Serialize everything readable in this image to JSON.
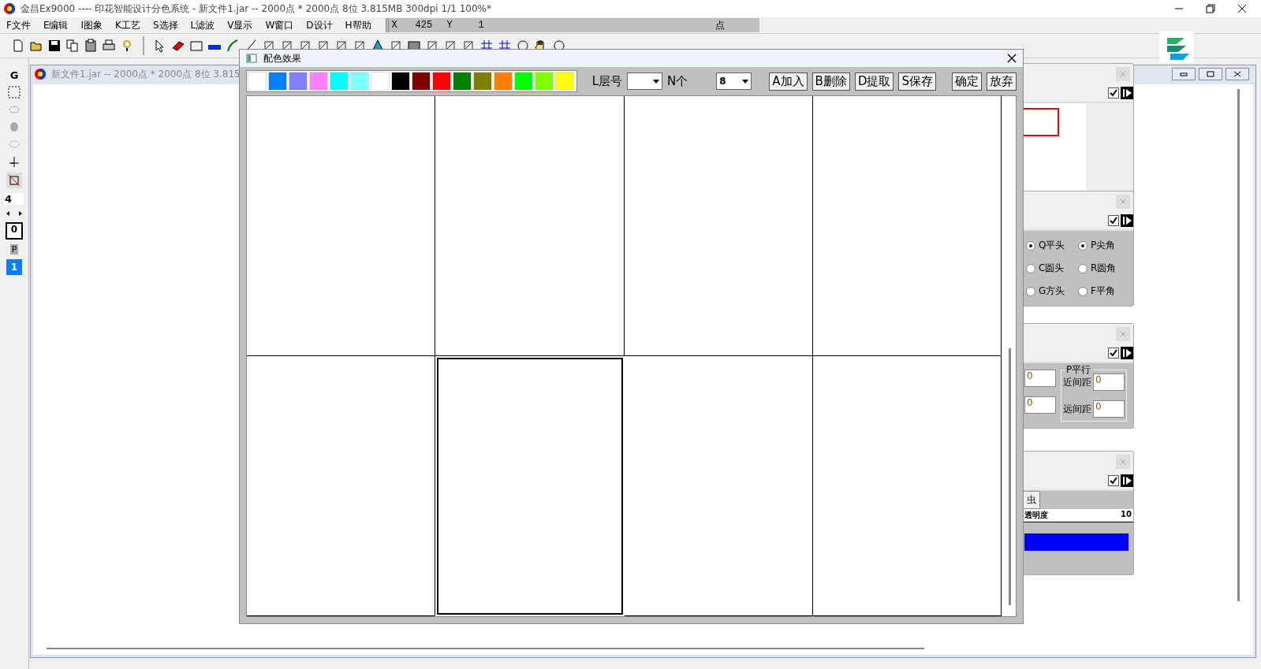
{
  "window": {
    "title": "金昌Ex9000 ---- 印花智能设计分色系统 - 新文件1.jar -- 2000点 * 2000点 8位   3.815MB 300dpi 1/1    100%*"
  },
  "menu": [
    "F文件",
    "E编辑",
    "I图象",
    "K工艺",
    "S选择",
    "L滤波",
    "V显示",
    "W窗口",
    "D设计",
    "H帮助"
  ],
  "status": {
    "x_label": "X",
    "x_value": "425",
    "y_label": "Y",
    "y_value": "1",
    "unit": "点"
  },
  "toolbox": {
    "label": "G",
    "size": "4",
    "layer": "0",
    "mode": "P",
    "page": "1"
  },
  "document": {
    "title": "新文件1.jar -- 2000点 * 2000点 8位   3.815"
  },
  "dialog": {
    "title": "配色效果",
    "swatches": [
      {
        "color": "#ffffff"
      },
      {
        "color": "#0080ff"
      },
      {
        "color": "#8080ff"
      },
      {
        "color": "#ff80ff"
      },
      {
        "color": "#00ffff"
      },
      {
        "color": "#80ffff"
      },
      {
        "color": "#ffffff"
      },
      {
        "color": "#000000"
      },
      {
        "color": "#800000"
      },
      {
        "color": "#ff0000"
      },
      {
        "color": "#008000"
      },
      {
        "color": "#808000"
      },
      {
        "color": "#ff8000"
      },
      {
        "color": "#00ff00"
      },
      {
        "color": "#80ff00"
      },
      {
        "color": "#ffff00"
      }
    ],
    "layer_label": "L层号",
    "count_label": "N个",
    "count_value": "8",
    "buttons": [
      "A加入",
      "B删除",
      "D提取",
      "S保存",
      "确定",
      "放弃"
    ],
    "cells": [
      {
        "selected": false
      },
      {
        "selected": false
      },
      {
        "selected": false
      },
      {
        "selected": false
      },
      {
        "selected": false
      },
      {
        "selected": true
      },
      {
        "selected": false
      },
      {
        "selected": false
      }
    ]
  },
  "panels": [
    {
      "kind": "preview",
      "checked": true
    },
    {
      "kind": "radios",
      "checked": true,
      "options": [
        {
          "label": "Q平头",
          "selected": true
        },
        {
          "label": "P尖角",
          "selected": true
        },
        {
          "label": "C圆头",
          "selected": false
        },
        {
          "label": "R圆角",
          "selected": false
        },
        {
          "label": "G方头",
          "selected": false
        },
        {
          "label": "F平角",
          "selected": false
        }
      ]
    },
    {
      "kind": "spacing",
      "checked": true,
      "left_values": [
        "0",
        "0"
      ],
      "group": "P平行",
      "fields": [
        {
          "label": "近间距",
          "value": "0"
        },
        {
          "label": "远间距",
          "value": "0"
        }
      ]
    },
    {
      "kind": "layers",
      "checked": true,
      "tab": "虫",
      "column": "透明度",
      "reading": "10"
    }
  ]
}
